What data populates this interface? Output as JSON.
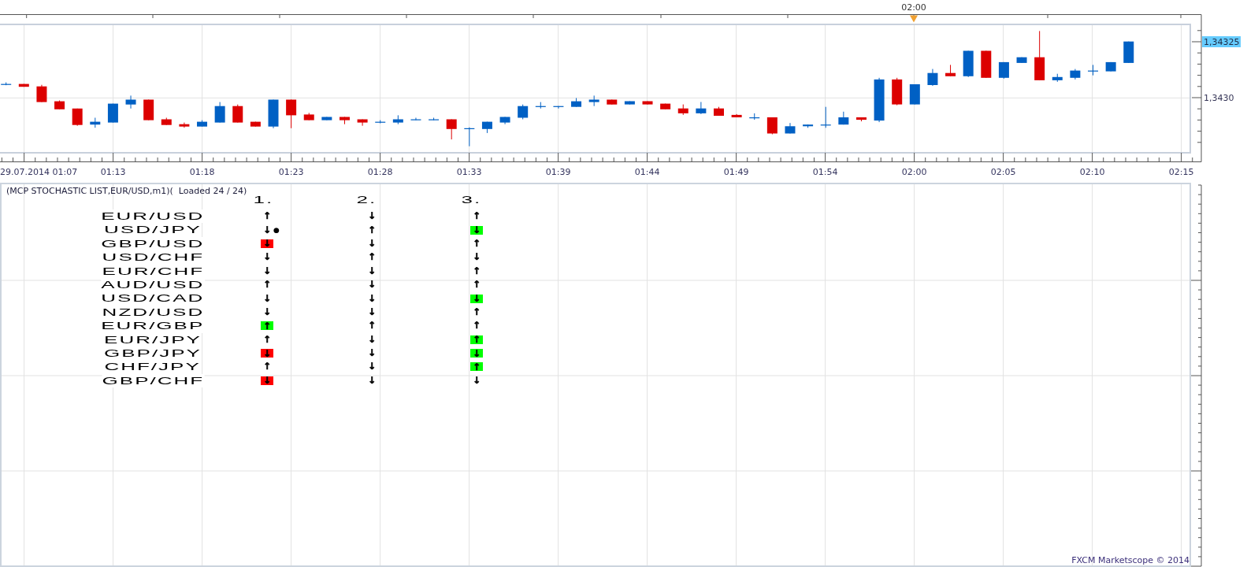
{
  "price_chart": {
    "marker_label": "02:00",
    "price_labels": [
      {
        "text": "1,34325",
        "kind": "current"
      },
      {
        "text": "1,3430",
        "kind": "level"
      }
    ],
    "time_labels": [
      "29.07.2014 01:07",
      "01:13",
      "01:18",
      "01:23",
      "01:28",
      "01:33",
      "01:39",
      "01:44",
      "01:49",
      "01:54",
      "02:00",
      "02:05",
      "02:10",
      "02:15"
    ]
  },
  "indicator_panel": {
    "title": "(MCP STOCHASTIC LIST,EUR/USD,m1)(  Loaded 24 / 24)",
    "columns": [
      "1.",
      "2.",
      "3."
    ],
    "rows": [
      {
        "pair": "EUR/USD",
        "signals": [
          {
            "arrow": "↑"
          },
          {
            "arrow": "↓"
          },
          {
            "arrow": "↑"
          }
        ]
      },
      {
        "pair": "USD/JPY",
        "signals": [
          {
            "arrow": "↓",
            "marker": "●"
          },
          {
            "arrow": "↑"
          },
          {
            "arrow": "↓",
            "color": "#00ff00"
          }
        ]
      },
      {
        "pair": "GBP/USD",
        "signals": [
          {
            "arrow": "↓",
            "color": "#ff0000"
          },
          {
            "arrow": "↓"
          },
          {
            "arrow": "↑"
          }
        ]
      },
      {
        "pair": "USD/CHF",
        "signals": [
          {
            "arrow": "↓"
          },
          {
            "arrow": "↑"
          },
          {
            "arrow": "↓"
          }
        ]
      },
      {
        "pair": "EUR/CHF",
        "signals": [
          {
            "arrow": "↓"
          },
          {
            "arrow": "↓"
          },
          {
            "arrow": "↑"
          }
        ]
      },
      {
        "pair": "AUD/USD",
        "signals": [
          {
            "arrow": "↑"
          },
          {
            "arrow": "↓"
          },
          {
            "arrow": "↑"
          }
        ]
      },
      {
        "pair": "USD/CAD",
        "signals": [
          {
            "arrow": "↓"
          },
          {
            "arrow": "↓"
          },
          {
            "arrow": "↓",
            "color": "#00ff00"
          }
        ]
      },
      {
        "pair": "NZD/USD",
        "signals": [
          {
            "arrow": "↓"
          },
          {
            "arrow": "↓"
          },
          {
            "arrow": "↑"
          }
        ]
      },
      {
        "pair": "EUR/GBP",
        "signals": [
          {
            "arrow": "↑",
            "color": "#00ff00"
          },
          {
            "arrow": "↑"
          },
          {
            "arrow": "↑"
          }
        ]
      },
      {
        "pair": "EUR/JPY",
        "signals": [
          {
            "arrow": "↑"
          },
          {
            "arrow": "↓"
          },
          {
            "arrow": "↑",
            "color": "#00ff00"
          }
        ]
      },
      {
        "pair": "GBP/JPY",
        "signals": [
          {
            "arrow": "↓",
            "color": "#ff0000"
          },
          {
            "arrow": "↓"
          },
          {
            "arrow": "↓",
            "color": "#00ff00"
          }
        ]
      },
      {
        "pair": "CHF/JPY",
        "signals": [
          {
            "arrow": "↑"
          },
          {
            "arrow": "↓"
          },
          {
            "arrow": "↑",
            "color": "#00ff00"
          }
        ]
      },
      {
        "pair": "GBP/CHF",
        "signals": [
          {
            "arrow": "↓",
            "color": "#ff0000"
          },
          {
            "arrow": "↓"
          },
          {
            "arrow": "↓"
          }
        ]
      }
    ]
  },
  "footer": "FXCM Marketscope © 2014"
}
